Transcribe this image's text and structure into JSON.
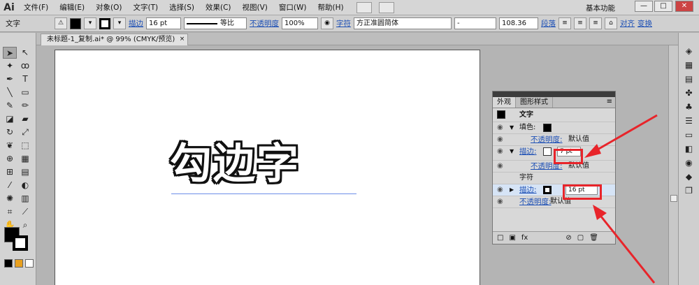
{
  "app": {
    "logo": "Ai"
  },
  "menu": [
    "文件(F)",
    "编辑(E)",
    "对象(O)",
    "文字(T)",
    "选择(S)",
    "效果(C)",
    "视图(V)",
    "窗口(W)",
    "帮助(H)"
  ],
  "workspace": "基本功能",
  "window_buttons": {
    "min": "—",
    "max": "□",
    "close": "✕"
  },
  "control": {
    "type_label": "文字",
    "stroke_label": "描边",
    "stroke_value": "16 pt",
    "profile": "等比",
    "opacity_label": "不透明度",
    "opacity_value": "100%",
    "char_label": "字符",
    "font": "方正准圆简体",
    "style": "-",
    "size": "108.36",
    "para_label": "段落",
    "align_label": "对齐",
    "transform_label": "变换"
  },
  "document": {
    "tab_title": "未标题-1_复制.ai* @ 99% (CMYK/预览)",
    "close": "×"
  },
  "artwork": {
    "text": "勾边字"
  },
  "panel": {
    "tab_appearance": "外观",
    "tab_styles": "图形样式",
    "title": "文字",
    "fill_label": "填色:",
    "stroke1_label": "描边:",
    "stroke1_value": "7 pt",
    "opacity_link": "不透明度:",
    "opacity_default": "默认值",
    "char_label": "字符",
    "stroke2_label": "描边:",
    "stroke2_value": "16 pt",
    "fx": "fx"
  },
  "colors": {
    "highlight": "#e8242a",
    "link": "#1c4fb5"
  }
}
